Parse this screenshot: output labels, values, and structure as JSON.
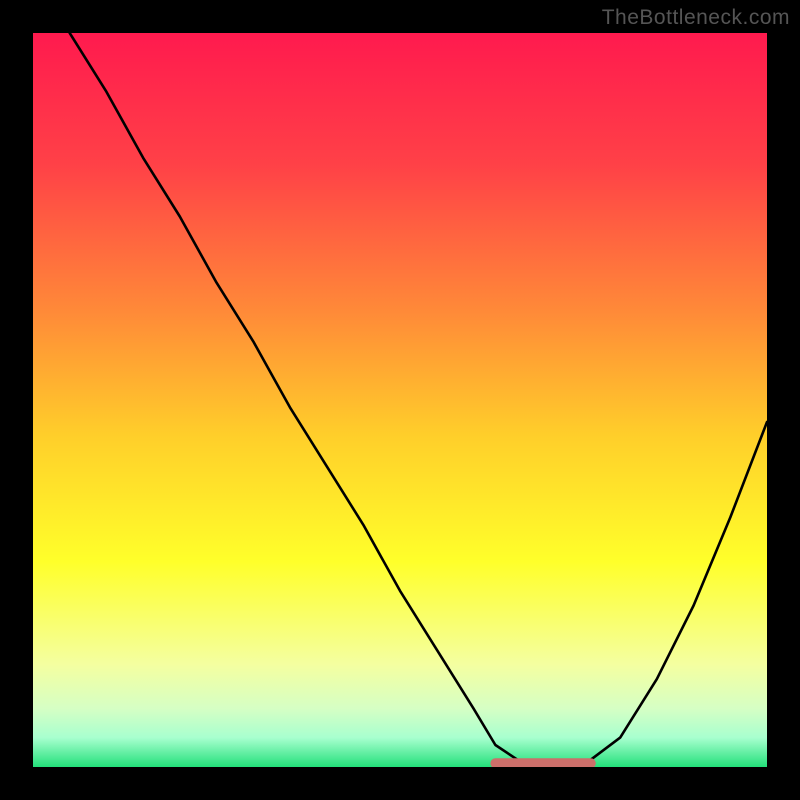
{
  "watermark": "TheBottleneck.com",
  "colors": {
    "gradient_stops": [
      {
        "pct": 0,
        "color": "#ff1a4e"
      },
      {
        "pct": 18,
        "color": "#ff4147"
      },
      {
        "pct": 38,
        "color": "#ff8a38"
      },
      {
        "pct": 55,
        "color": "#ffcf2a"
      },
      {
        "pct": 72,
        "color": "#ffff2a"
      },
      {
        "pct": 86,
        "color": "#f4ffa0"
      },
      {
        "pct": 92,
        "color": "#d6ffc4"
      },
      {
        "pct": 96,
        "color": "#a8ffcf"
      },
      {
        "pct": 100,
        "color": "#23e07a"
      }
    ],
    "curve": "#000000",
    "marker_fill": "#cc6f6a",
    "marker_stroke": "#a84f4a",
    "frame": "#000000"
  },
  "chart_data": {
    "type": "line",
    "title": "",
    "xlabel": "",
    "ylabel": "",
    "xlim": [
      0,
      100
    ],
    "ylim": [
      0,
      100
    ],
    "note": "Bottleneck-style V-curve; no axes/ticks rendered. Values estimated from pixel positions (y=0 at bottom, y=100 at top).",
    "series": [
      {
        "name": "bottleneck-curve",
        "x": [
          5,
          10,
          15,
          20,
          25,
          30,
          35,
          40,
          45,
          50,
          55,
          60,
          63,
          66,
          70,
          73,
          76,
          80,
          85,
          90,
          95,
          100
        ],
        "y": [
          100,
          92,
          83,
          75,
          66,
          58,
          49,
          41,
          33,
          24,
          16,
          8,
          3,
          1,
          0.5,
          0.5,
          1,
          4,
          12,
          22,
          34,
          47
        ]
      }
    ],
    "annotations": [
      {
        "name": "min-plateau-marker",
        "shape": "rounded-segment",
        "x_range": [
          63,
          76
        ],
        "y": 0.5
      }
    ]
  }
}
